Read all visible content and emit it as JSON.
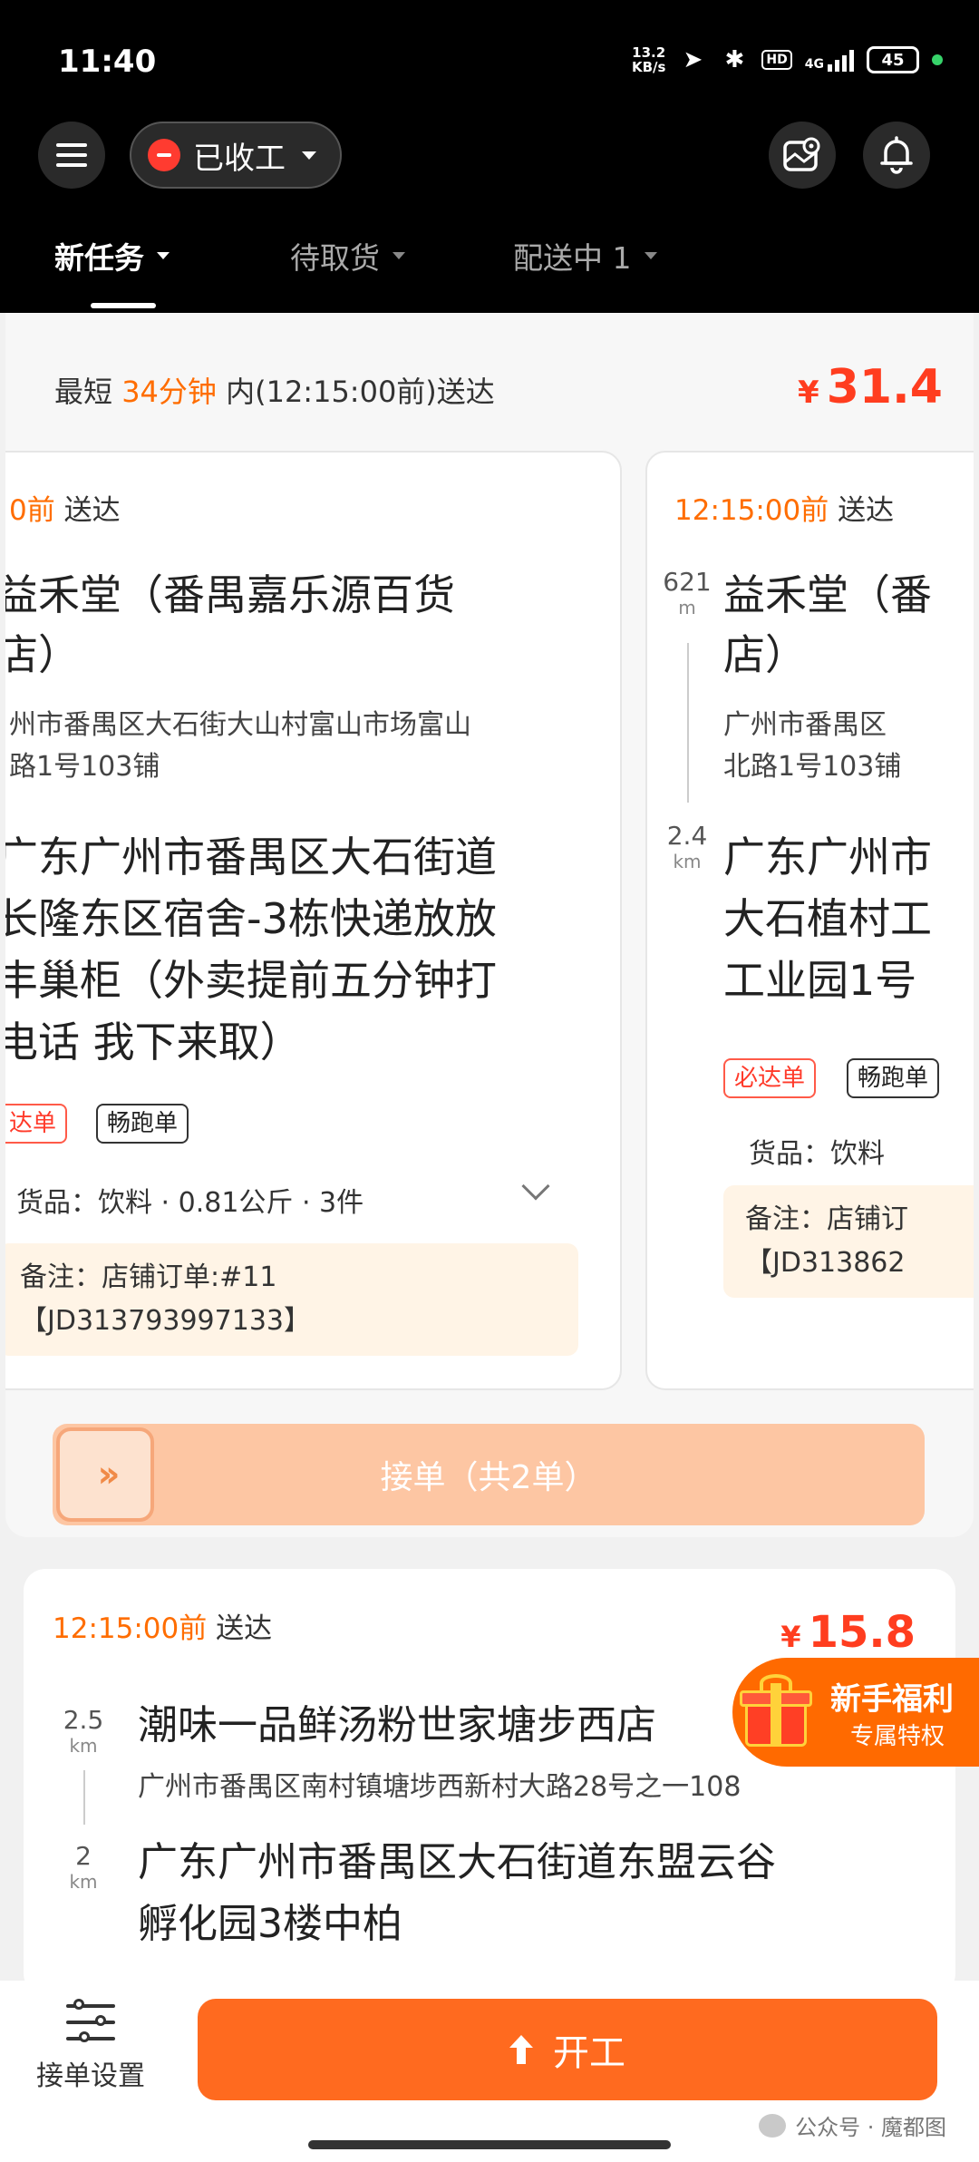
{
  "status_bar": {
    "time": "11:40",
    "net_speed_value": "13.2",
    "net_speed_unit": "KB/s",
    "hd_label": "HD",
    "network": "4G",
    "battery": "45"
  },
  "header": {
    "work_status": "已收工",
    "tabs": [
      {
        "label": "新任务"
      },
      {
        "label": "待取货"
      },
      {
        "label": "配送中 1"
      }
    ]
  },
  "order_group": {
    "time_prefix": "最短",
    "time_minutes": "34分钟",
    "time_suffix": "内(12:15:00前)送达",
    "price_symbol": "¥",
    "price": "31.4",
    "left_card": {
      "deadline": "0前",
      "deliver_label": "送达",
      "store_line1": "益禾堂（番禺嘉乐源百货",
      "store_line2": "店）",
      "store_addr_line1": "州市番禺区大石街大山村富山市场富山",
      "store_addr_line2": "路1号103铺",
      "dest_line1": "广东广州市番禺区大石街道",
      "dest_line2": "长隆东区宿舍-3栋快递放放",
      "dest_line3": "丰巢柜（外卖提前五分钟打",
      "dest_line4": "电话 我下来取）",
      "tag_must": "达单",
      "tag_smooth": "畅跑单",
      "goods": "货品：饮料 · 0.81公斤 · 3件",
      "remark_line1": "备注：店铺订单:#11",
      "remark_line2": "【JD313793997133】"
    },
    "right_card": {
      "deadline": "12:15:00前",
      "deliver_label": "送达",
      "dist1_value": "621",
      "dist1_unit": "m",
      "dist2_value": "2.4",
      "dist2_unit": "km",
      "store_line1": "益禾堂（番",
      "store_line2": "店）",
      "store_addr_line1": "广州市番禺区",
      "store_addr_line2": "北路1号103铺",
      "dest_line1": "广东广州市",
      "dest_line2": "大石植村工",
      "dest_line3": "工业园1号",
      "tag_must": "必达单",
      "tag_smooth": "畅跑单",
      "goods": "货品：饮料",
      "remark_line1": "备注：店铺订",
      "remark_line2": "【JD313862"
    },
    "accept_button": "接单（共2单）"
  },
  "order2": {
    "deadline": "12:15:00前",
    "deliver_label": "送达",
    "price_symbol": "¥",
    "price": "15.8",
    "dist1_value": "2.5",
    "dist1_unit": "km",
    "dist2_value": "2",
    "dist2_unit": "km",
    "store": "潮味一品鲜汤粉世家塘步西店",
    "store_addr": "广州市番禺区南村镇塘埗西新村大路28号之一108",
    "dest_line1": "广东广州市番禺区大石街道东盟云谷",
    "dest_line2": "孵化园3楼中柏"
  },
  "promo": {
    "title": "新手福利",
    "subtitle": "专属特权"
  },
  "bottom_bar": {
    "settings_label": "接单设置",
    "start_button": "开工",
    "wechat_watermark": "公众号 · 魔都图"
  }
}
